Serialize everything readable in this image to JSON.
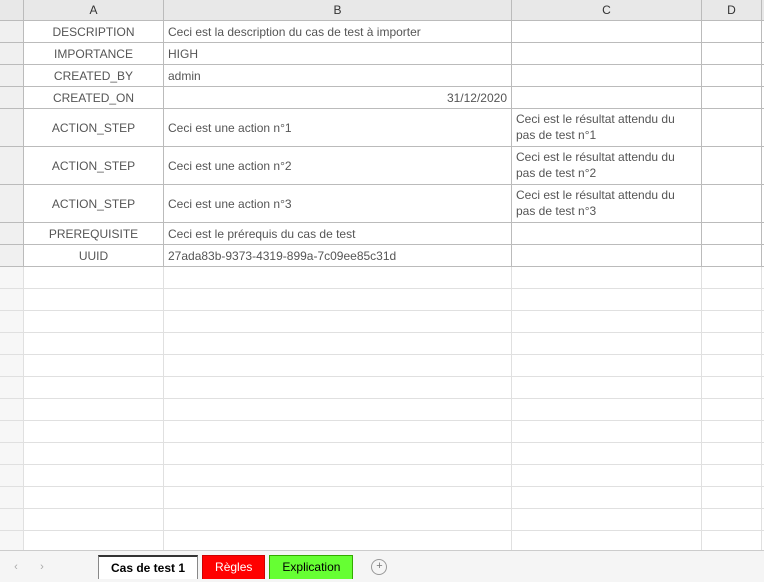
{
  "columns": {
    "A": "A",
    "B": "B",
    "C": "C",
    "D": "D"
  },
  "rows": [
    {
      "a": "DESCRIPTION",
      "b": "Ceci est la description du cas de test à importer",
      "c": "",
      "b_align": "left",
      "double": false
    },
    {
      "a": "IMPORTANCE",
      "b": "HIGH",
      "c": "",
      "b_align": "left",
      "double": false
    },
    {
      "a": "CREATED_BY",
      "b": "admin",
      "c": "",
      "b_align": "left",
      "double": false
    },
    {
      "a": "CREATED_ON",
      "b": "31/12/2020",
      "c": "",
      "b_align": "right",
      "double": false
    },
    {
      "a": "ACTION_STEP",
      "b": "Ceci est une action n°1",
      "c": "Ceci est le résultat attendu du pas de test n°1",
      "b_align": "left",
      "double": true
    },
    {
      "a": "ACTION_STEP",
      "b": "Ceci est une action n°2",
      "c": "Ceci est le résultat attendu du pas de test n°2",
      "b_align": "left",
      "double": true
    },
    {
      "a": "ACTION_STEP",
      "b": "Ceci est une action n°3",
      "c": "Ceci est le résultat attendu du pas de test n°3",
      "b_align": "left",
      "double": true
    },
    {
      "a": "PREREQUISITE",
      "b": "Ceci est le prérequis du cas de test",
      "c": "",
      "b_align": "left",
      "double": false
    },
    {
      "a": "UUID",
      "b": "27ada83b-9373-4319-899a-7c09ee85c31d",
      "c": "",
      "b_align": "left",
      "double": false
    }
  ],
  "empty_rows": 13,
  "tabs": {
    "nav_prev": "‹",
    "nav_next": "›",
    "items": [
      {
        "label": "Cas de test 1",
        "style": "active"
      },
      {
        "label": "Règles",
        "style": "regles"
      },
      {
        "label": "Explication",
        "style": "explic"
      }
    ],
    "add": "+"
  }
}
